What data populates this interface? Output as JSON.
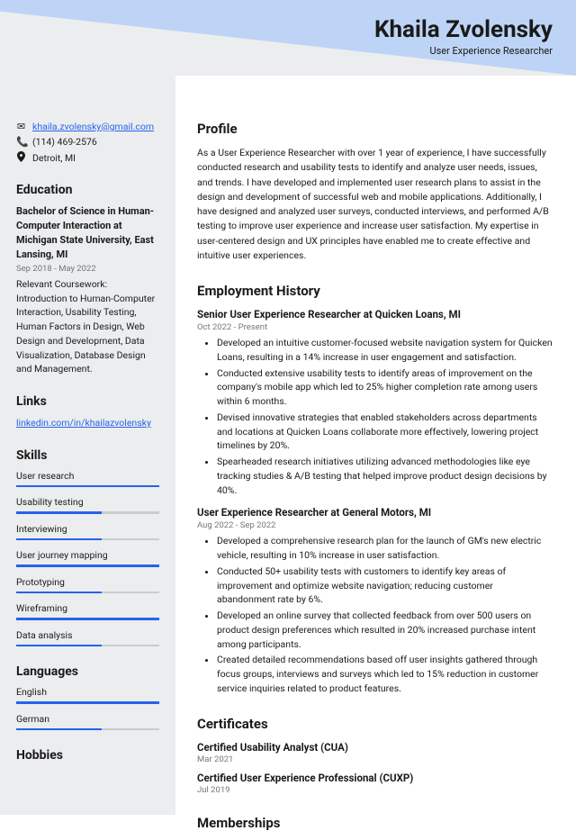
{
  "name": "Khaila Zvolensky",
  "title": "User Experience Researcher",
  "contact": {
    "email": "khaila.zvolensky@gmail.com",
    "phone": "(114) 469-2576",
    "location": "Detroit, MI"
  },
  "education": {
    "heading": "Education",
    "degree": "Bachelor of Science in Human-Computer Interaction at Michigan State University, East Lansing, MI",
    "dates": "Sep 2018 - May 2022",
    "body": "Relevant Coursework: Introduction to Human-Computer Interaction, Usability Testing, Human Factors in Design, Web Design and Development, Data Visualization, Database Design and Management."
  },
  "links": {
    "heading": "Links",
    "url": "linkedin.com/in/khailazvolensky"
  },
  "skills": {
    "heading": "Skills",
    "items": [
      {
        "name": "User research",
        "level": 100
      },
      {
        "name": "Usability testing",
        "level": 60
      },
      {
        "name": "Interviewing",
        "level": 60
      },
      {
        "name": "User journey mapping",
        "level": 100
      },
      {
        "name": "Prototyping",
        "level": 60
      },
      {
        "name": "Wireframing",
        "level": 100
      },
      {
        "name": "Data analysis",
        "level": 60
      }
    ]
  },
  "languages": {
    "heading": "Languages",
    "items": [
      {
        "name": "English",
        "level": 100
      },
      {
        "name": "German",
        "level": 60
      }
    ]
  },
  "hobbies_heading": "Hobbies",
  "profile": {
    "heading": "Profile",
    "text": "As a User Experience Researcher with over 1 year of experience, I have successfully conducted research and usability tests to identify and analyze user needs, issues, and trends. I have developed and implemented user research plans to assist in the design and development of successful web and mobile applications. Additionally, I have designed and analyzed user surveys, conducted interviews, and performed A/B testing to improve user experience and increase user satisfaction. My expertise in user-centered design and UX principles have enabled me to create effective and intuitive user experiences."
  },
  "employment": {
    "heading": "Employment History",
    "jobs": [
      {
        "title": "Senior User Experience Researcher at Quicken Loans, MI",
        "dates": "Oct 2022 - Present",
        "bullets": [
          "Developed an intuitive customer-focused website navigation system for Quicken Loans, resulting in a 14% increase in user engagement and satisfaction.",
          "Conducted extensive usability tests to identify areas of improvement on the company's mobile app which led to 25% higher completion rate among users within 6 months.",
          "Devised innovative strategies that enabled stakeholders across departments and locations at Quicken Loans collaborate more effectively, lowering project timelines by 20%.",
          "Spearheaded research initiatives utilizing advanced methodologies like eye tracking studies & A/B testing that helped improve product design decisions by 40%."
        ]
      },
      {
        "title": "User Experience Researcher at General Motors, MI",
        "dates": "Aug 2022 - Sep 2022",
        "bullets": [
          "Developed a comprehensive research plan for the launch of GM's new electric vehicle, resulting in 10% increase in user satisfaction.",
          "Conducted 50+ usability tests with customers to identify key areas of improvement and optimize website navigation; reducing customer abandonment rate by 6%.",
          "Developed an online survey that collected feedback from over 500 users on product design preferences which resulted in 20% increased purchase intent among participants.",
          "Created detailed recommendations based off user insights gathered through focus groups, interviews and surveys which led to 15% reduction in customer service inquiries related to product features."
        ]
      }
    ]
  },
  "certificates": {
    "heading": "Certificates",
    "items": [
      {
        "title": "Certified Usability Analyst (CUA)",
        "date": "Mar 2021"
      },
      {
        "title": "Certified User Experience Professional (CUXP)",
        "date": "Jul 2019"
      }
    ]
  },
  "memberships_heading": "Memberships"
}
